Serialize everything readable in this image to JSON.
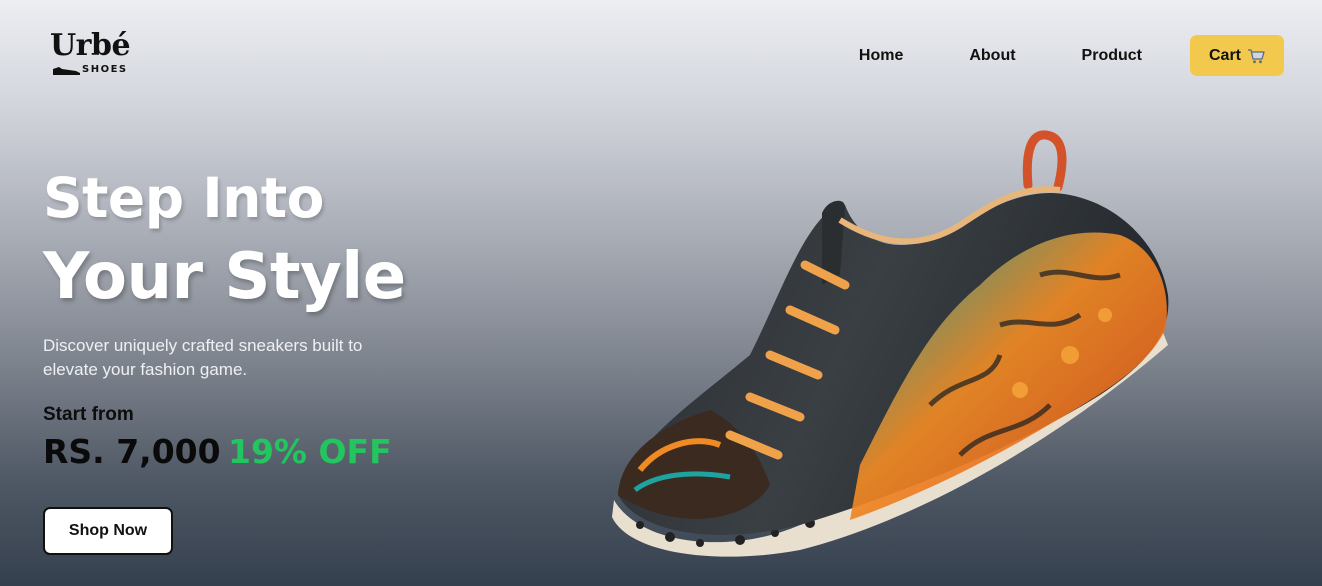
{
  "brand": {
    "name": "Urbé",
    "tagline": "SHOES"
  },
  "nav": {
    "links": [
      "Home",
      "About",
      "Product"
    ],
    "cart_label": "Cart"
  },
  "hero": {
    "title_line1": "Step Into",
    "title_line2": "Your Style",
    "description": "Discover uniquely crafted sneakers built to elevate your fashion game.",
    "start_label": "Start from",
    "price": "RS. 7,000",
    "discount": "19% OFF",
    "cta": "Shop Now"
  },
  "colors": {
    "accent_button": "#f2c94c",
    "discount_green": "#22c55e",
    "text_dark": "#111111"
  },
  "icons": {
    "cart": "cart-icon",
    "logo_shoe": "shoe-icon"
  }
}
